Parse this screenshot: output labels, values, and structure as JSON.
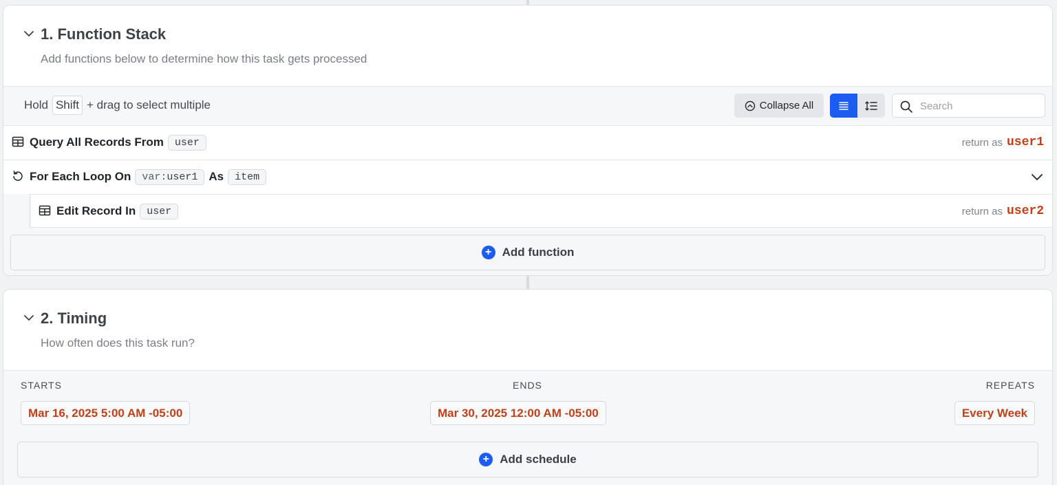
{
  "function_stack": {
    "title": "1. Function Stack",
    "subtitle": "Add functions below to determine how this task gets processed",
    "hint_before": "Hold",
    "hint_key": "Shift",
    "hint_after": "+ drag to select multiple",
    "collapse_all_label": "Collapse All",
    "search_placeholder": "Search",
    "functions": [
      {
        "icon": "table-icon",
        "label": "Query All Records From",
        "table": "user",
        "return_label": "return as",
        "return_var": "user1"
      },
      {
        "icon": "loop-icon",
        "label": "For Each Loop On",
        "var_prefix": "var:",
        "var_name": "user1",
        "as_label": "As",
        "item_name": "item"
      },
      {
        "icon": "table-icon",
        "label": "Edit Record In",
        "table": "user",
        "return_label": "return as",
        "return_var": "user2"
      }
    ],
    "add_function_label": "Add function"
  },
  "timing": {
    "title": "2. Timing",
    "subtitle": "How often does this task run?",
    "starts_label": "STARTS",
    "starts_value": "Mar 16, 2025 5:00 AM -05:00",
    "ends_label": "ENDS",
    "ends_value": "Mar 30, 2025 12:00 AM -05:00",
    "repeats_label": "REPEATS",
    "repeats_value": "Every Week",
    "add_schedule_label": "Add schedule"
  },
  "colors": {
    "accent": "#1d5cf0",
    "variable": "#c0401a"
  }
}
